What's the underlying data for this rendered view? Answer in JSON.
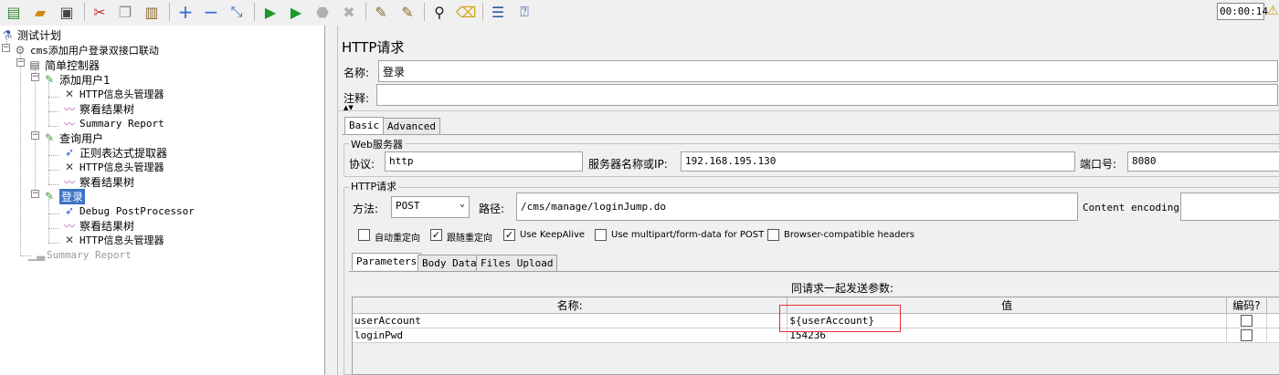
{
  "toolbar": {
    "icons": [
      "new-icon",
      "open-icon",
      "save-icon",
      "cut-icon",
      "copy-icon",
      "paste-icon",
      "expand-icon",
      "collapse-icon",
      "toggle-icon",
      "start-icon",
      "start-no-pause-icon",
      "stop-icon",
      "shutdown-icon",
      "clear-icon",
      "clear-all-icon",
      "search-icon",
      "reset-search-icon",
      "function-helper-icon",
      "help-icon"
    ],
    "timer": "00:00:14"
  },
  "tree": {
    "test_plan": "测试计划",
    "thread_group": "cms添加用户登录双接口联动",
    "simple_controller": "简单控制器",
    "sampler_add_user": "添加用户1",
    "add_user_children": [
      "HTTP信息头管理器",
      "察看结果树",
      "Summary Report"
    ],
    "sampler_query_user": "查询用户",
    "query_user_children": [
      "正则表达式提取器",
      "HTTP信息头管理器",
      "察看结果树"
    ],
    "sampler_login": "登录",
    "login_children": [
      "Debug PostProcessor",
      "察看结果树",
      "HTTP信息头管理器"
    ],
    "summary_report_disabled": "Summary Report"
  },
  "panel": {
    "title": "HTTP请求",
    "name_label": "名称:",
    "name_value": "登录",
    "comment_label": "注释:",
    "comment_value": "",
    "tabs": [
      "Basic",
      "Advanced"
    ],
    "web_server": {
      "legend": "Web服务器",
      "protocol_label": "协议:",
      "protocol_value": "http",
      "server_label": "服务器名称或IP:",
      "server_value": "192.168.195.130",
      "port_label": "端口号:",
      "port_value": "8080"
    },
    "http_request": {
      "legend": "HTTP请求",
      "method_label": "方法:",
      "method_value": "POST",
      "path_label": "路径:",
      "path_value": "/cms/manage/loginJump.do",
      "encoding_label": "Content encoding:",
      "encoding_value": ""
    },
    "options": [
      {
        "label": "自动重定向",
        "checked": false
      },
      {
        "label": "跟随重定向",
        "checked": true
      },
      {
        "label": "Use KeepAlive",
        "checked": true
      },
      {
        "label": "Use multipart/form-data for POST",
        "checked": false
      },
      {
        "label": "Browser-compatible headers",
        "checked": false
      }
    ],
    "param_tabs": [
      "Parameters",
      "Body Data",
      "Files Upload"
    ],
    "params_caption": "同请求一起发送参数:",
    "columns": [
      "名称:",
      "值",
      "编码?"
    ],
    "rows": [
      {
        "name": "userAccount",
        "value": "${userAccount}",
        "encode": false
      },
      {
        "name": "loginPwd",
        "value": "154236",
        "encode": false
      }
    ],
    "highlight_color": "#e03030"
  }
}
